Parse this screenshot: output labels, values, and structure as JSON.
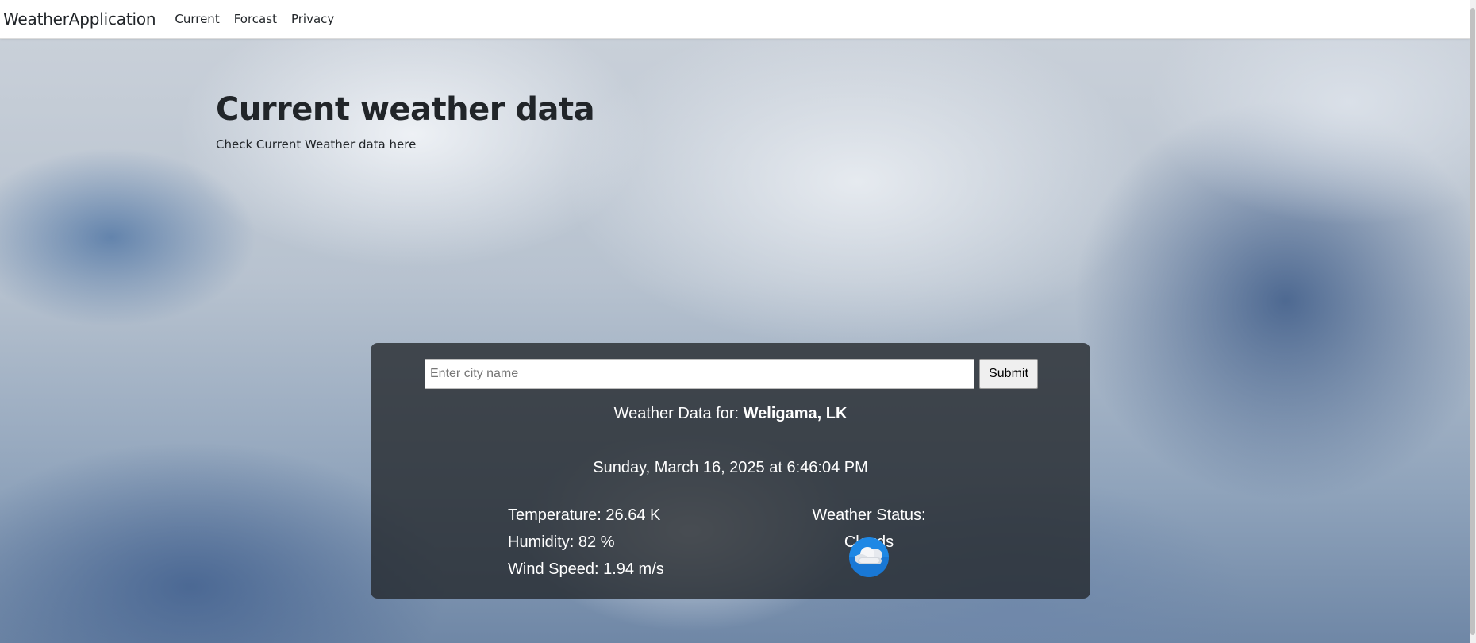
{
  "navbar": {
    "brand": "WeatherApplication",
    "links": [
      "Current",
      "Forcast",
      "Privacy"
    ]
  },
  "hero": {
    "title": "Current weather data",
    "subtitle": "Check Current Weather data here"
  },
  "search": {
    "placeholder": "Enter city name",
    "value": "",
    "submit_label": "Submit"
  },
  "weather": {
    "for_label": "Weather Data for: ",
    "location": "Weligama, LK",
    "datetime": "Sunday, March 16, 2025 at 6:46:04 PM",
    "temperature": "Temperature: 26.64 K",
    "humidity": "Humidity: 82 %",
    "wind_speed": "Wind Speed: 1.94 m/s",
    "status": "Weather Status: Clouds",
    "icon": "clouds-icon"
  },
  "colors": {
    "card_background": "#212529",
    "navbar_background": "#ffffff",
    "text_dark": "#212529",
    "icon_blue": "#1e88e5"
  }
}
